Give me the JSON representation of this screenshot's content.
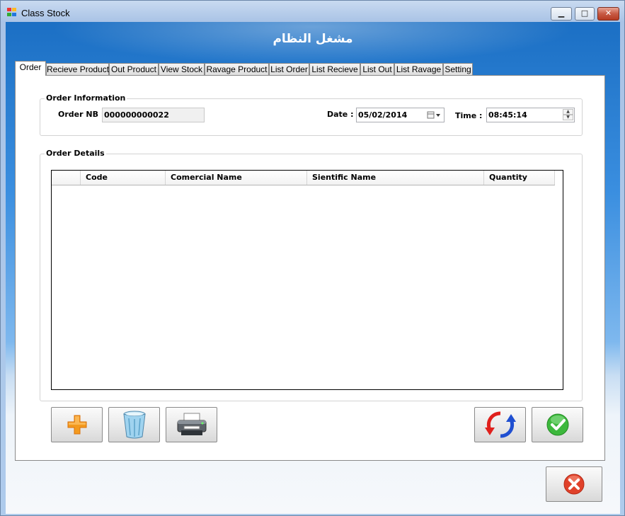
{
  "window": {
    "title": "Class Stock",
    "minimize_glyph": "▁",
    "maximize_glyph": "□",
    "close_glyph": "✕"
  },
  "header": {
    "title": "مشغل النظام"
  },
  "tabs": [
    {
      "label": "Order",
      "active": true
    },
    {
      "label": "Recieve Product"
    },
    {
      "label": "Out Product"
    },
    {
      "label": "View Stock"
    },
    {
      "label": "Ravage Product"
    },
    {
      "label": "List Order"
    },
    {
      "label": "List Recieve"
    },
    {
      "label": "List Out"
    },
    {
      "label": "List Ravage"
    },
    {
      "label": "Setting"
    }
  ],
  "order_info": {
    "title": "Order Information",
    "order_nb_label": "Order NB :",
    "order_nb_value": "000000000022",
    "date_label": "Date :",
    "date_value": "05/02/2014",
    "time_label": "Time :",
    "time_value": "08:45:14"
  },
  "order_details": {
    "title": "Order Details",
    "columns": [
      "Code",
      "Comercial Name",
      "Sientific Name",
      "Quantity"
    ],
    "rows": []
  },
  "buttons": {
    "add": "plus-icon",
    "delete": "recycle-bin-icon",
    "print": "printer-icon",
    "refresh": "refresh-icon",
    "confirm": "checkmark-icon",
    "close": "close-icon"
  },
  "colors": {
    "accent_blue": "#1b6fc4",
    "plus_orange": "#f39a1e",
    "confirm_green": "#3db83d",
    "close_red": "#e0412a"
  }
}
